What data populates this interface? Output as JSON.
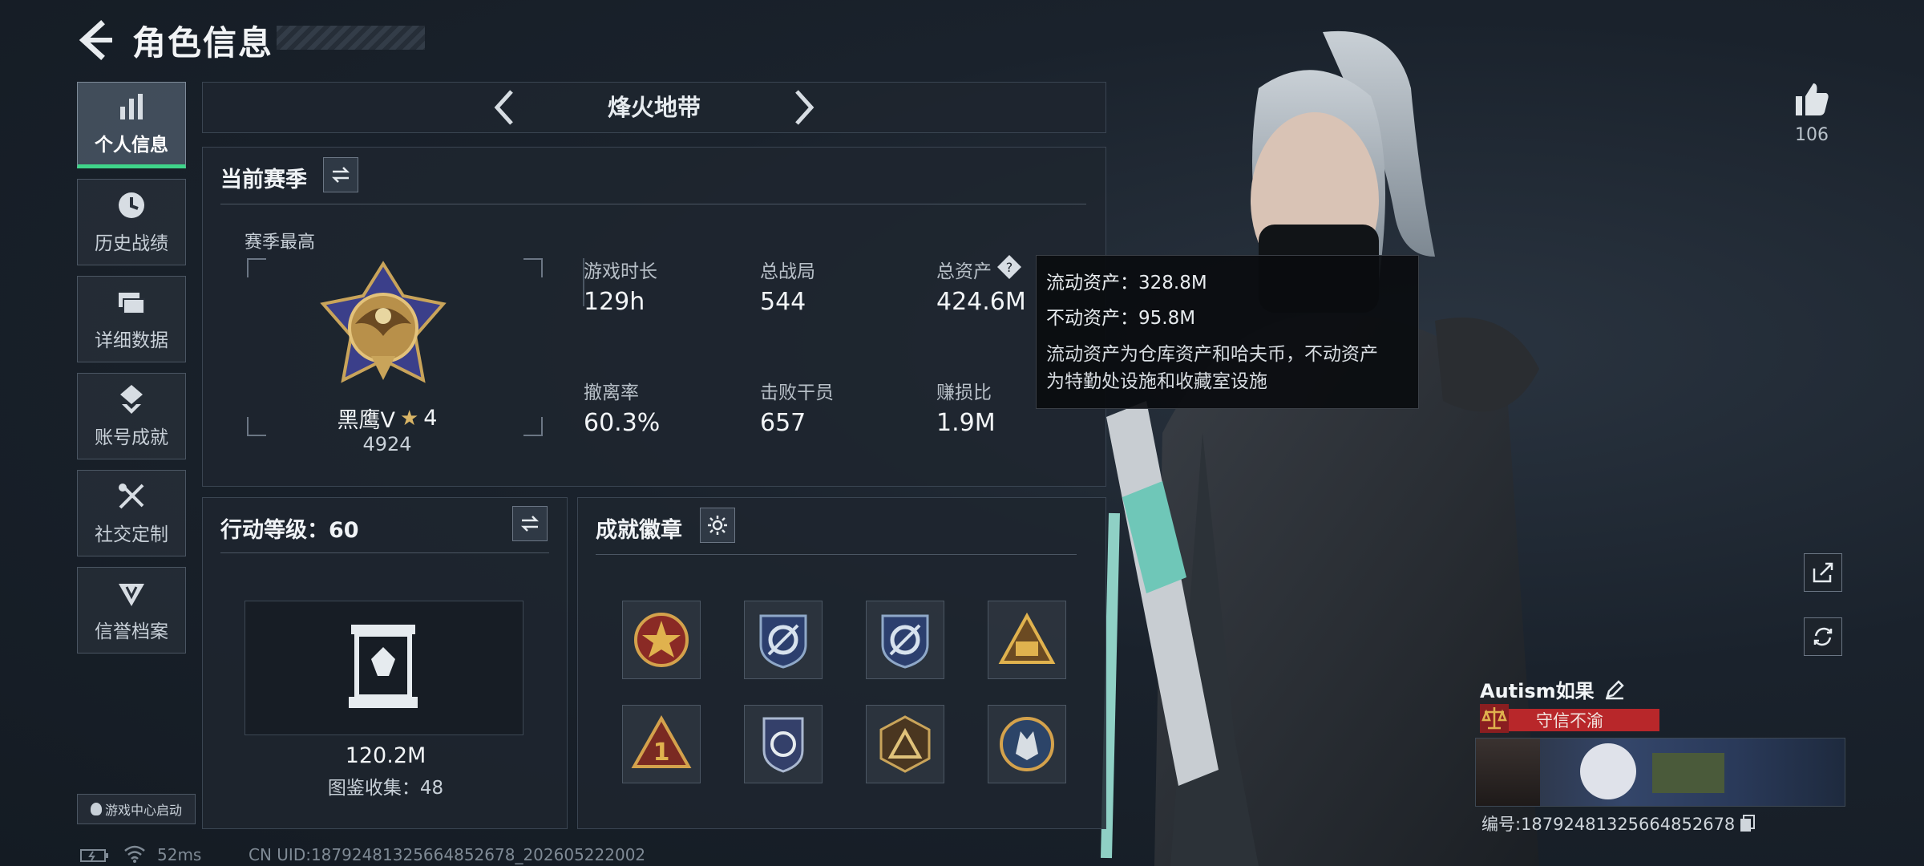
{
  "header": {
    "title": "角色信息"
  },
  "nav": {
    "items": [
      {
        "label": "个人信息",
        "icon": "bar-chart-icon",
        "active": true
      },
      {
        "label": "历史战绩",
        "icon": "clock-icon",
        "active": false
      },
      {
        "label": "详细数据",
        "icon": "cards-icon",
        "active": false
      },
      {
        "label": "账号成就",
        "icon": "achievement-icon",
        "active": false
      },
      {
        "label": "社交定制",
        "icon": "tools-icon",
        "active": false
      },
      {
        "label": "信誉档案",
        "icon": "shield-icon",
        "active": false
      }
    ],
    "launch_label": "游戏中心启动"
  },
  "mode": {
    "name": "烽火地带"
  },
  "current_season": {
    "title": "当前赛季",
    "best_label": "赛季最高",
    "rank_name": "黑鹰V",
    "rank_stars": "4",
    "rank_score": "4924",
    "stats": [
      {
        "label": "游戏时长",
        "value": "129h"
      },
      {
        "label": "总战局",
        "value": "544"
      },
      {
        "label": "总资产",
        "value": "424.6M"
      },
      {
        "label": "撤离率",
        "value": "60.3%"
      },
      {
        "label": "击败干员",
        "value": "657"
      },
      {
        "label": "赚损比",
        "value": "1.9M"
      }
    ]
  },
  "tooltip": {
    "liquid": "流动资产：328.8M",
    "fixed": "不动资产：95.8M",
    "desc_line1": "流动资产为仓库资产和哈夫币，不动资产",
    "desc_line2": "为特勤处设施和收藏室设施"
  },
  "action_level": {
    "title": "行动等级：60",
    "value": "120.2M",
    "collection": "图鉴收集：48"
  },
  "achievements": {
    "title": "成就徽章",
    "badges": [
      "star-emblem-icon",
      "gear-emblem-icon",
      "gear-emblem-icon",
      "triangle-emblem-icon",
      "rank-one-icon",
      "shield-emblem-icon",
      "pyramid-emblem-icon",
      "wolf-emblem-icon"
    ]
  },
  "profile": {
    "likes": "106",
    "name": "Autism如果",
    "motto": "守信不渝",
    "id_text": "编号:18792481325664852678"
  },
  "status_bar": {
    "ping": "52ms",
    "uid": "CN UID:18792481325664852678_202605222002"
  },
  "colors": {
    "accent_green": "#3fd58a",
    "motto_red": "#b8272a"
  }
}
